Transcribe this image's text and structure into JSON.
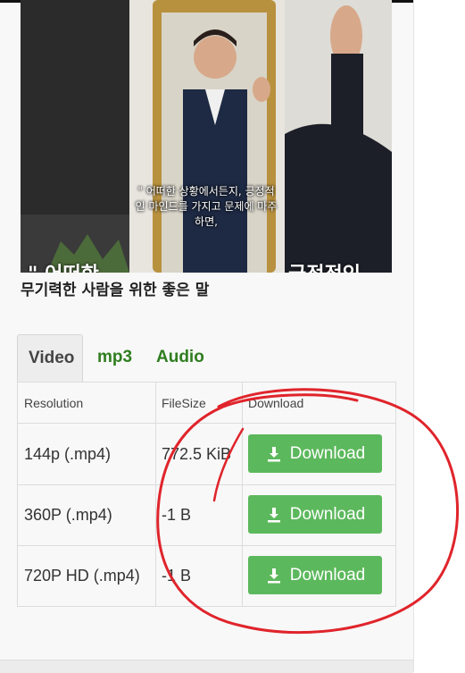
{
  "video": {
    "caption": "\" 어떠한 상황에서든지, 긍정적인 마인드를 가지고 문제에 마주하면,",
    "overlay_left": "\" 어떠한",
    "overlay_right": "긍정적인",
    "title": "무기력한 사람을 위한 좋은 말"
  },
  "tabs": [
    {
      "label": "Video",
      "active": true
    },
    {
      "label": "mp3",
      "active": false
    },
    {
      "label": "Audio",
      "active": false
    }
  ],
  "table": {
    "headers": [
      "Resolution",
      "FileSize",
      "Download"
    ],
    "rows": [
      {
        "resolution": "144p (.mp4)",
        "filesize": "772.5 KiB",
        "button": "Download"
      },
      {
        "resolution": "360P (.mp4)",
        "filesize": "-1 B",
        "button": "Download"
      },
      {
        "resolution": "720P HD (.mp4)",
        "filesize": "-1 B",
        "button": "Download"
      }
    ]
  },
  "colors": {
    "accent_green": "#5cb85c",
    "tab_link_green": "#2f7d1f",
    "annotation_red": "#e0242b"
  },
  "icons": {
    "download": "download-icon"
  }
}
